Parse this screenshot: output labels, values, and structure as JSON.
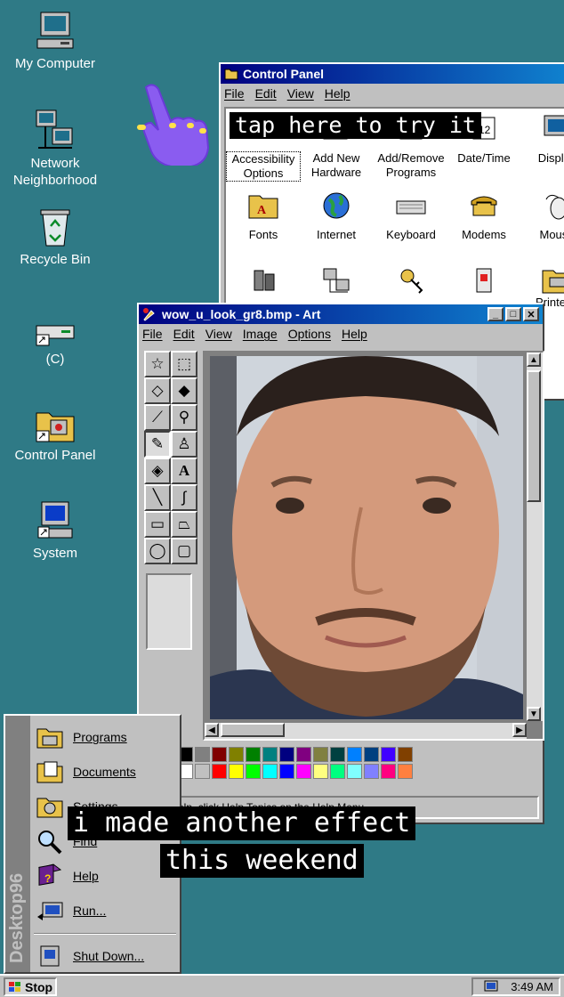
{
  "desktop": {
    "icons": [
      {
        "label": "My Computer",
        "icon": "computer-icon"
      },
      {
        "label": "Network Neighborhood",
        "icon": "network-icon"
      },
      {
        "label": "Recycle Bin",
        "icon": "recycle-bin-icon"
      },
      {
        "label": "(C)",
        "icon": "drive-icon"
      },
      {
        "label": "Control Panel",
        "icon": "control-panel-icon"
      },
      {
        "label": "System",
        "icon": "system-icon"
      }
    ]
  },
  "control_panel": {
    "title": "Control Panel",
    "menu": [
      "File",
      "Edit",
      "View",
      "Help"
    ],
    "items": [
      {
        "label": "Accessibility Options"
      },
      {
        "label": "Add New Hardware"
      },
      {
        "label": "Add/Remove Programs"
      },
      {
        "label": "Date/Time"
      },
      {
        "label": "Display"
      },
      {
        "label": "Fonts"
      },
      {
        "label": "Internet"
      },
      {
        "label": "Keyboard"
      },
      {
        "label": "Modems"
      },
      {
        "label": "Mouse"
      },
      {
        "label": "Printer"
      }
    ]
  },
  "paint": {
    "title": "wow_u_look_gr8.bmp - Art",
    "menu": [
      "File",
      "Edit",
      "View",
      "Image",
      "Options",
      "Help"
    ],
    "status_text": "For Help, click Help Topics on the Help Menu.",
    "palette": [
      "#000000",
      "#808080",
      "#800000",
      "#808000",
      "#008000",
      "#008080",
      "#000080",
      "#800080",
      "#808040",
      "#004040",
      "#0080ff",
      "#004080",
      "#4000ff",
      "#804000",
      "#ffffff",
      "#c0c0c0",
      "#ff0000",
      "#ffff00",
      "#00ff00",
      "#00ffff",
      "#0000ff",
      "#ff00ff",
      "#ffff80",
      "#00ff80",
      "#80ffff",
      "#8080ff",
      "#ff0080",
      "#ff8040"
    ]
  },
  "start_menu": {
    "brand": "Desktop96",
    "items": [
      {
        "label": "Programs",
        "icon": "programs-icon"
      },
      {
        "label": "Documents",
        "icon": "documents-icon"
      },
      {
        "label": "Settings",
        "icon": "settings-icon"
      },
      {
        "label": "Find",
        "icon": "find-icon"
      },
      {
        "label": "Help",
        "icon": "help-icon"
      },
      {
        "label": "Run...",
        "icon": "run-icon"
      },
      {
        "label": "Shut Down...",
        "icon": "shutdown-icon"
      }
    ]
  },
  "taskbar": {
    "start_label": "Stop",
    "clock": "3:49 AM"
  },
  "overlay": {
    "tap_caption": "tap here to try it",
    "caption_line1": "i made another effect",
    "caption_line2": "this weekend"
  },
  "colors": {
    "desktop": "#2f7a86",
    "titlebar": "#000080",
    "window": "#c0c0c0",
    "hand": "#8a5cf0"
  }
}
